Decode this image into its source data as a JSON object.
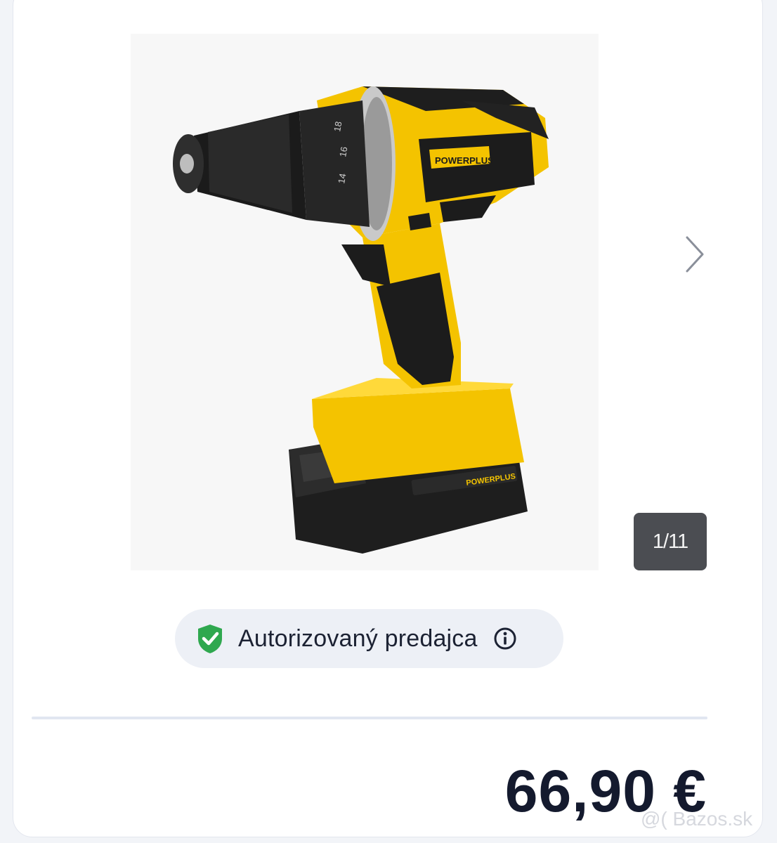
{
  "gallery": {
    "image_alt": "Cordless drill with battery",
    "brand_on_tool": "POWERPLUS",
    "counter": "1/11"
  },
  "badge": {
    "label": "Autorizovaný predajca"
  },
  "price": {
    "value": "66,90 €"
  },
  "watermark": {
    "text": "@( Bazos.sk"
  },
  "colors": {
    "accent_yellow": "#f6c500",
    "shield_green": "#2fa84f",
    "price_text": "#141a2e"
  },
  "icons": [
    "chevron-right-icon",
    "shield-check-icon",
    "info-icon"
  ]
}
